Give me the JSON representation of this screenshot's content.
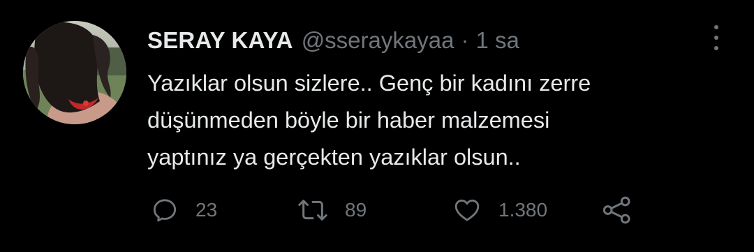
{
  "tweet": {
    "display_name": "SERAY KAYA",
    "handle": "@sseraykayaa",
    "separator": "·",
    "time": "1 sa",
    "text_lines": [
      "Yazıklar olsun sizlere.. Genç bir kadını zerre",
      "düşünmeden böyle bir haber malzemesi",
      "yaptınız ya gerçekten yazıklar olsun.."
    ]
  },
  "actions": {
    "reply": {
      "icon": "reply-icon",
      "count": "23"
    },
    "retweet": {
      "icon": "retweet-icon",
      "count": "89"
    },
    "like": {
      "icon": "heart-icon",
      "count": "1.380"
    },
    "share": {
      "icon": "share-icon"
    }
  },
  "colors": {
    "background": "#000000",
    "primary_text": "#e7e9ea",
    "secondary_text": "#71767b"
  }
}
